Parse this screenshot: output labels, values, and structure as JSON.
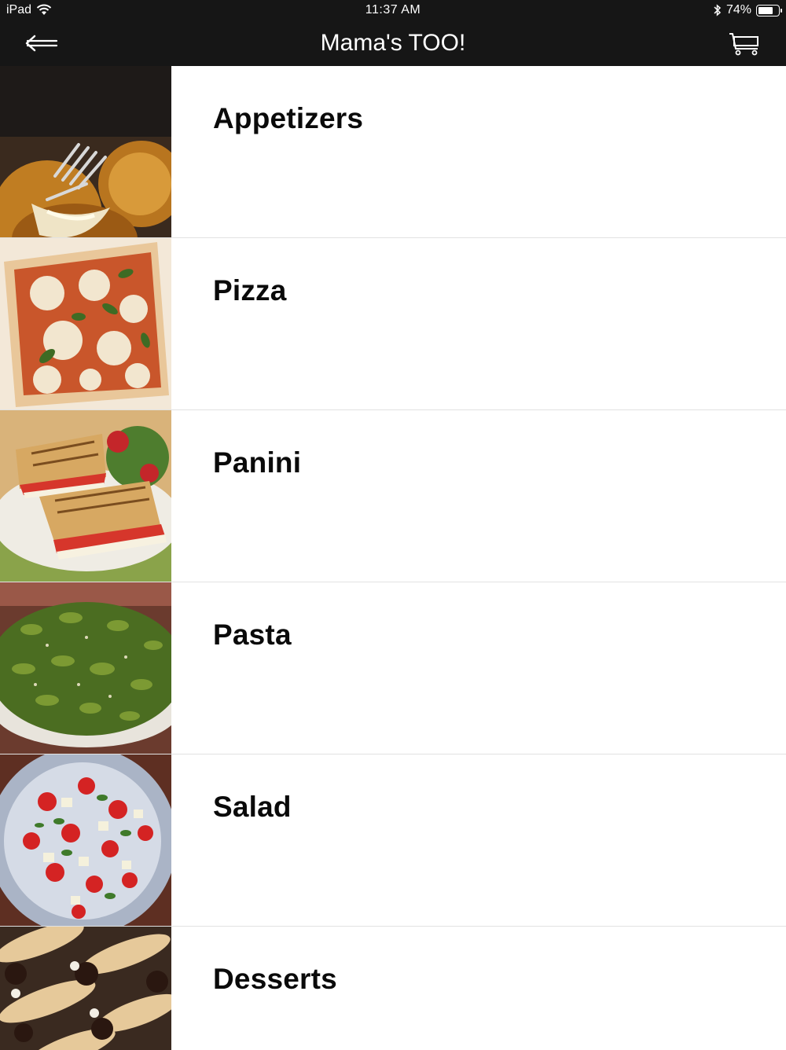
{
  "status_bar": {
    "device": "iPad",
    "time": "11:37 AM",
    "battery": "74%",
    "battery_level": 0.74
  },
  "nav": {
    "title": "Mama's TOO!",
    "back_icon": "back-arrow-icon",
    "cart_icon": "cart-icon"
  },
  "menu": {
    "items": [
      {
        "label": "Appetizers",
        "image": "arancini-photo"
      },
      {
        "label": "Pizza",
        "image": "pizza-photo"
      },
      {
        "label": "Panini",
        "image": "panini-photo"
      },
      {
        "label": "Pasta",
        "image": "pesto-pasta-photo"
      },
      {
        "label": "Salad",
        "image": "caprese-salad-photo"
      },
      {
        "label": "Desserts",
        "image": "cannoli-photo"
      }
    ]
  }
}
